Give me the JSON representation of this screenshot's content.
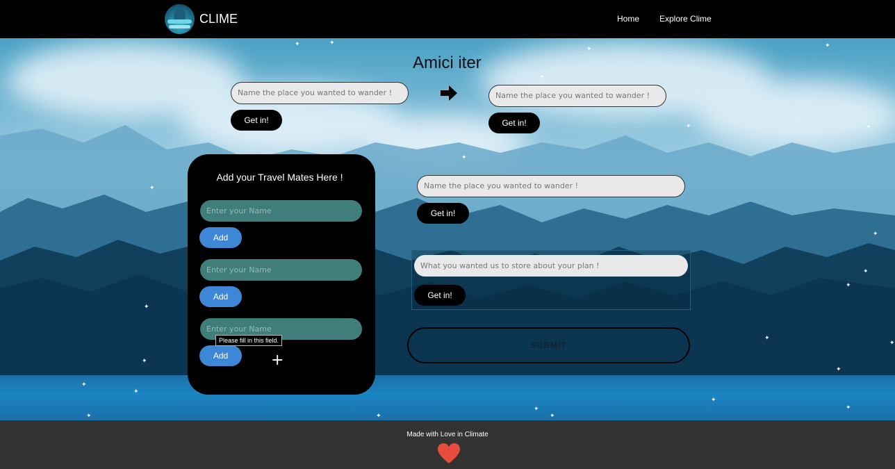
{
  "header": {
    "brand": "CLIME",
    "nav": [
      {
        "label": "Home"
      },
      {
        "label": "Explore Clime"
      }
    ]
  },
  "main": {
    "title": "Amici iter",
    "place_placeholder": "Name the place you wanted to wander !",
    "get_in_label": "Get in!",
    "plan_placeholder": "What you wanted us to store about your plan !",
    "submit_label": "SUBMIT"
  },
  "mates_card": {
    "title": "Add your Travel Mates Here !",
    "name_placeholder": "Enter your Name",
    "add_label": "Add",
    "tooltip": "Please fill in this field.",
    "plus": "+"
  },
  "footer": {
    "text": "Made with Love in Climate"
  },
  "colors": {
    "heart": "#e74c3c",
    "add_button": "#3d87d6",
    "name_field": "#3f7e7a",
    "footer_bg": "#333333"
  },
  "icons": [
    "logo-icon",
    "arrow-right-icon",
    "plus-icon",
    "heart-icon"
  ]
}
